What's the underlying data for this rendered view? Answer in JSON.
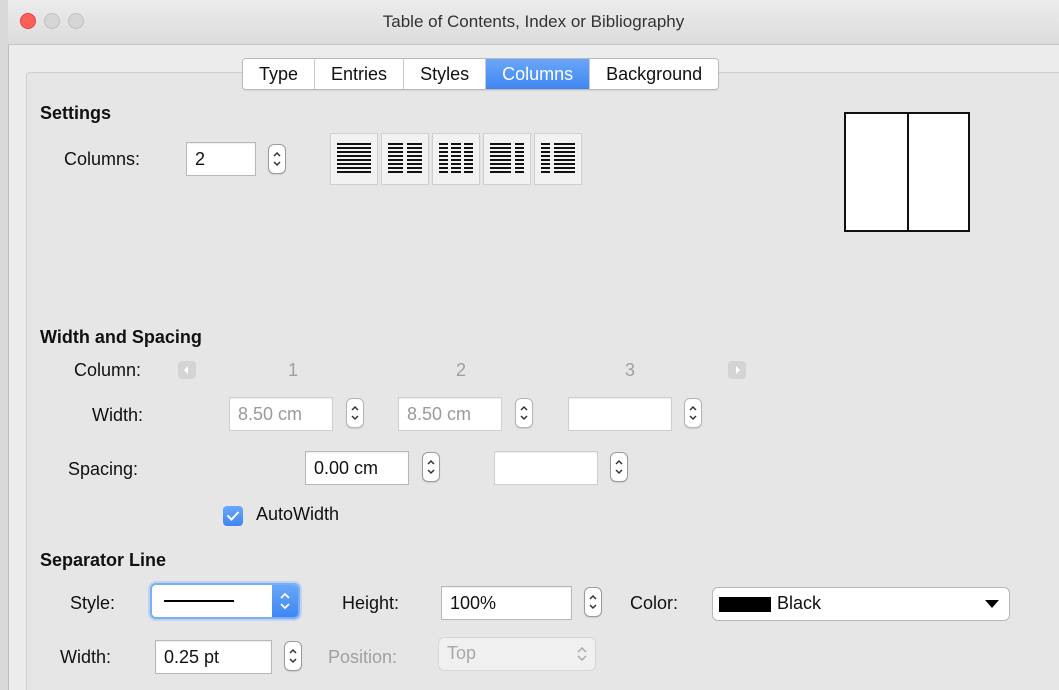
{
  "window": {
    "title": "Table of Contents, Index or Bibliography",
    "traffic_colors": {
      "close": "#fc5f57",
      "min": "#d6d6d6",
      "max": "#d6d6d6"
    }
  },
  "tabs": [
    {
      "label": "Type",
      "active": false
    },
    {
      "label": "Entries",
      "active": false
    },
    {
      "label": "Styles",
      "active": false
    },
    {
      "label": "Columns",
      "active": true
    },
    {
      "label": "Background",
      "active": false
    }
  ],
  "settings": {
    "heading": "Settings",
    "columns_label": "Columns:",
    "columns_value": "2",
    "preview_columns": 2
  },
  "width_spacing": {
    "heading": "Width and Spacing",
    "column_label": "Column:",
    "column_numbers": [
      "1",
      "2",
      "3"
    ],
    "width_label": "Width:",
    "widths": [
      "8.50 cm",
      "8.50 cm",
      ""
    ],
    "spacing_label": "Spacing:",
    "spacings": [
      "0.00 cm",
      ""
    ],
    "autowidth_label": "AutoWidth",
    "autowidth_checked": true
  },
  "separator": {
    "heading": "Separator Line",
    "style_label": "Style:",
    "height_label": "Height:",
    "height_value": "100%",
    "color_label": "Color:",
    "color_value": "Black",
    "color_swatch": "#000000",
    "width_label": "Width:",
    "width_value": "0.25 pt",
    "position_label": "Position:",
    "position_value": "Top"
  },
  "accent_color": "#3f86f2"
}
